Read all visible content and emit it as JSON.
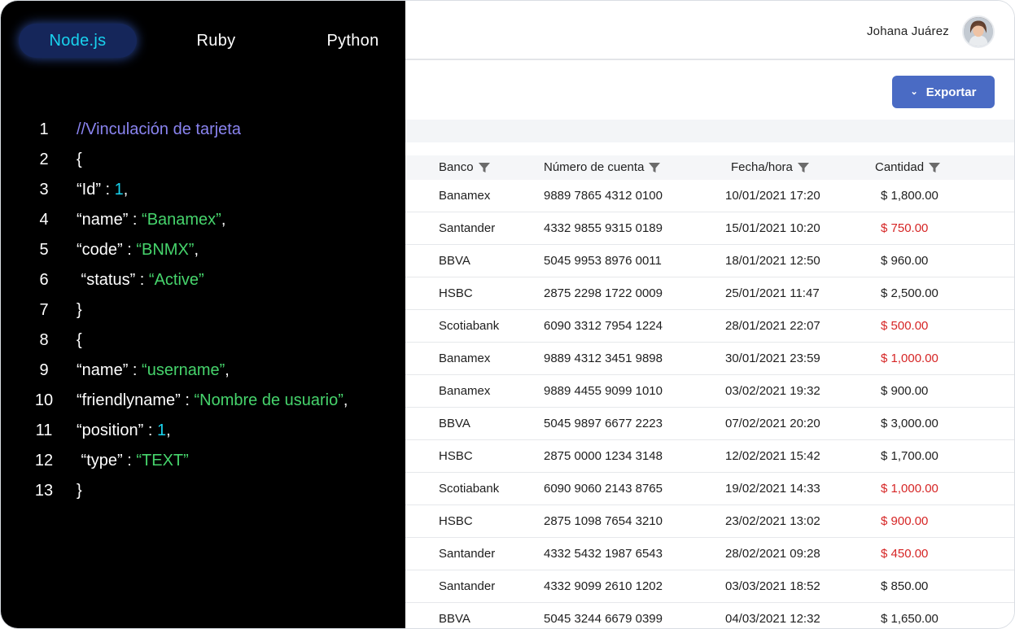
{
  "header": {
    "user_name": "Johana Juárez",
    "export_label": "Exportar"
  },
  "table": {
    "columns": [
      "Banco",
      "Número de cuenta",
      "Fecha/hora",
      "Cantidad"
    ],
    "rows": [
      {
        "bank": "Banamex",
        "account": "9889 7865 4312 0100",
        "datetime": "10/01/2021 17:20",
        "amount": "$ 1,800.00",
        "negative": false
      },
      {
        "bank": "Santander",
        "account": "4332 9855 9315 0189",
        "datetime": "15/01/2021 10:20",
        "amount": "$ 750.00",
        "negative": true
      },
      {
        "bank": "BBVA",
        "account": "5045 9953 8976 0011",
        "datetime": "18/01/2021 12:50",
        "amount": "$ 960.00",
        "negative": false
      },
      {
        "bank": "HSBC",
        "account": "2875 2298 1722 0009",
        "datetime": "25/01/2021 11:47",
        "amount": "$ 2,500.00",
        "negative": false
      },
      {
        "bank": "Scotiabank",
        "account": "6090 3312 7954 1224",
        "datetime": "28/01/2021 22:07",
        "amount": "$ 500.00",
        "negative": true
      },
      {
        "bank": "Banamex",
        "account": "9889  4312 3451 9898",
        "datetime": "30/01/2021 23:59",
        "amount": "$ 1,000.00",
        "negative": true
      },
      {
        "bank": "Banamex",
        "account": "9889 4455 9099 1010",
        "datetime": "03/02/2021 19:32",
        "amount": "$ 900.00",
        "negative": false
      },
      {
        "bank": "BBVA",
        "account": "5045 9897 6677 2223",
        "datetime": "07/02/2021 20:20",
        "amount": "$ 3,000.00",
        "negative": false
      },
      {
        "bank": "HSBC",
        "account": "2875 0000 1234 3148",
        "datetime": "12/02/2021 15:42",
        "amount": "$ 1,700.00",
        "negative": false
      },
      {
        "bank": "Scotiabank",
        "account": "6090 9060 2143 8765",
        "datetime": "19/02/2021 14:33",
        "amount": "$ 1,000.00",
        "negative": true
      },
      {
        "bank": "HSBC",
        "account": "2875 1098 7654 3210",
        "datetime": "23/02/2021 13:02",
        "amount": "$ 900.00",
        "negative": true
      },
      {
        "bank": "Santander",
        "account": "4332 5432 1987 6543",
        "datetime": "28/02/2021 09:28",
        "amount": "$ 450.00",
        "negative": true
      },
      {
        "bank": "Santander",
        "account": "4332 9099 2610 1202",
        "datetime": "03/03/2021 18:52",
        "amount": "$ 850.00",
        "negative": false
      },
      {
        "bank": "BBVA",
        "account": "5045 3244 6679 0399",
        "datetime": "04/03/2021 12:32",
        "amount": "$ 1,650.00",
        "negative": false
      }
    ]
  },
  "code_panel": {
    "tabs": [
      {
        "label": "Node.js",
        "active": true
      },
      {
        "label": "Ruby",
        "active": false
      },
      {
        "label": "Python",
        "active": false
      }
    ],
    "lines": [
      {
        "num": "1",
        "tokens": [
          {
            "t": "//Vinculación de tarjeta",
            "k": "comment"
          }
        ]
      },
      {
        "num": "2",
        "tokens": [
          {
            "t": "{",
            "k": "plain"
          }
        ]
      },
      {
        "num": "3",
        "tokens": [
          {
            "t": "“Id” : ",
            "k": "plain"
          },
          {
            "t": "1",
            "k": "num"
          },
          {
            "t": ",",
            "k": "plain"
          }
        ]
      },
      {
        "num": "4",
        "tokens": [
          {
            "t": "“name” : ",
            "k": "plain"
          },
          {
            "t": "“Banamex”",
            "k": "str"
          },
          {
            "t": ",",
            "k": "plain"
          }
        ]
      },
      {
        "num": "5",
        "tokens": [
          {
            "t": "“code” : ",
            "k": "plain"
          },
          {
            "t": "“BNMX”",
            "k": "str"
          },
          {
            "t": ",",
            "k": "plain"
          }
        ]
      },
      {
        "num": "6",
        "tokens": [
          {
            "t": " “status” : ",
            "k": "plain"
          },
          {
            "t": "“Active”",
            "k": "str"
          }
        ]
      },
      {
        "num": "7",
        "tokens": [
          {
            "t": "}",
            "k": "plain"
          }
        ]
      },
      {
        "num": "8",
        "tokens": [
          {
            "t": "{",
            "k": "plain"
          }
        ]
      },
      {
        "num": "9",
        "tokens": [
          {
            "t": "“name” : ",
            "k": "plain"
          },
          {
            "t": "“username”",
            "k": "str"
          },
          {
            "t": ",",
            "k": "plain"
          }
        ]
      },
      {
        "num": "10",
        "tokens": [
          {
            "t": "“friendlyname” : ",
            "k": "plain"
          },
          {
            "t": "“Nombre de usuario”",
            "k": "str"
          },
          {
            "t": ",",
            "k": "plain"
          }
        ]
      },
      {
        "num": "11",
        "tokens": [
          {
            "t": "“position” : ",
            "k": "plain"
          },
          {
            "t": "1",
            "k": "num"
          },
          {
            "t": ",",
            "k": "plain"
          }
        ]
      },
      {
        "num": "12",
        "tokens": [
          {
            "t": " “type” : ",
            "k": "plain"
          },
          {
            "t": "“TEXT”",
            "k": "str"
          }
        ]
      },
      {
        "num": "13",
        "tokens": [
          {
            "t": "}",
            "k": "plain"
          }
        ]
      }
    ]
  },
  "colors": {
    "accent": "#4a6bc4",
    "negative_amount": "#d62525",
    "code_string": "#46d46c",
    "code_number": "#19d3ee",
    "code_comment": "#8a84f0",
    "tab_active_bg": "#15265a"
  },
  "icons": {
    "filter": "filter-icon",
    "export_chevron": "chevron-down-icon",
    "avatar": "avatar"
  }
}
